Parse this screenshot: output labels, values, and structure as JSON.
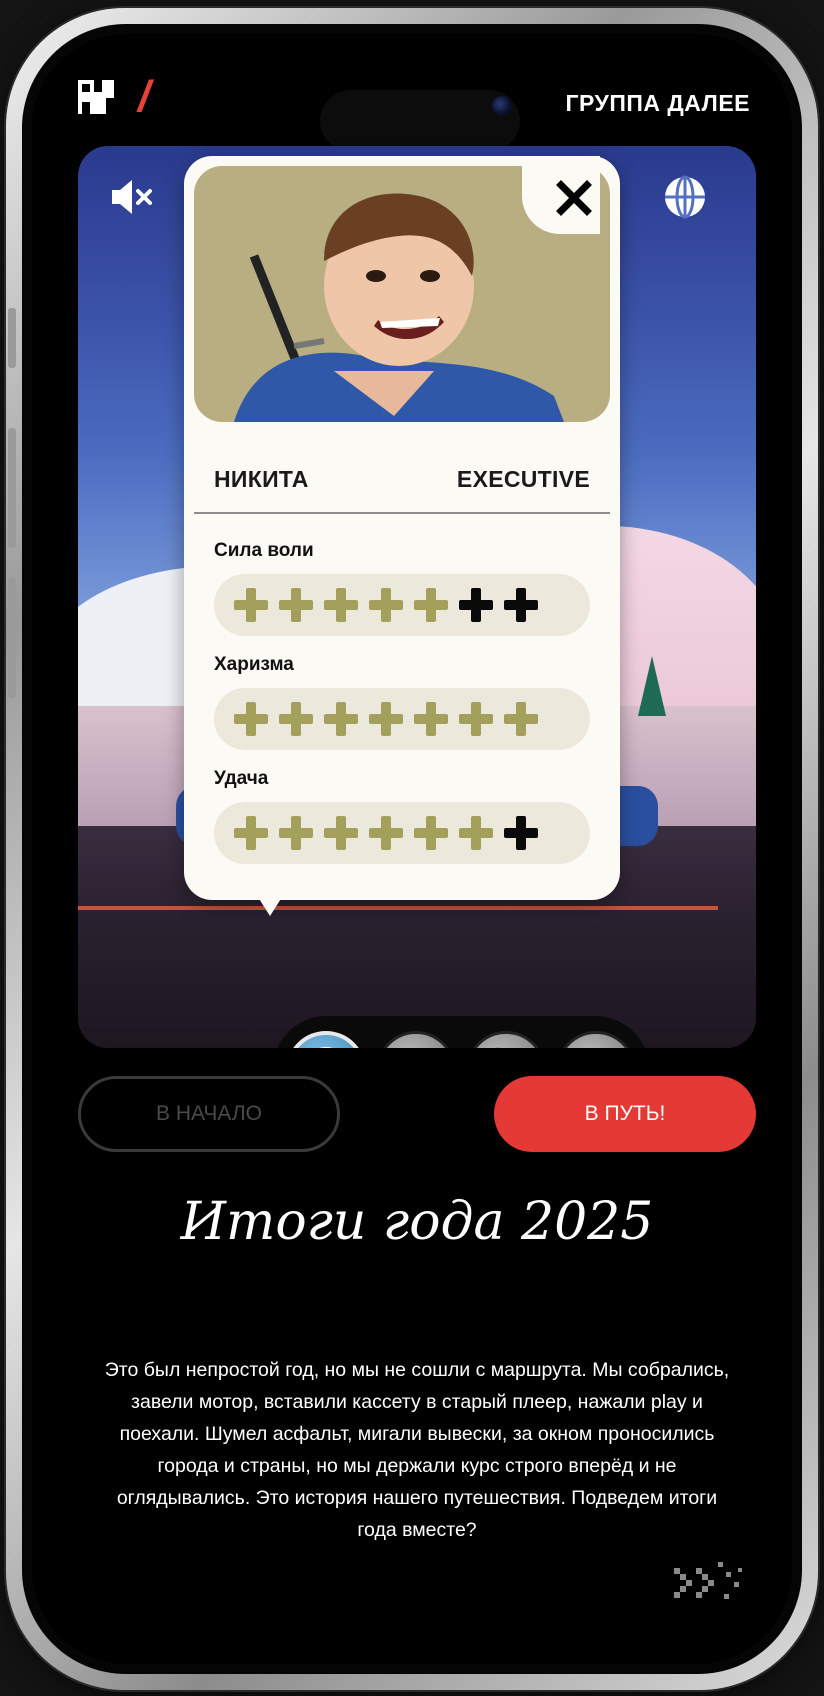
{
  "header": {
    "logo_mark": "N",
    "slash": "/",
    "nav_label": "ГРУППА ДАЛЕЕ"
  },
  "hero": {
    "icons": [
      "mute-icon",
      "globe-icon"
    ]
  },
  "card": {
    "name": "НИКИТА",
    "role": "EXECUTIVE",
    "stats": [
      {
        "label": "Сила воли",
        "value": 5,
        "max": 7
      },
      {
        "label": "Харизма",
        "value": 7,
        "max": 7
      },
      {
        "label": "Удача",
        "value": 6,
        "max": 7
      }
    ],
    "colors": {
      "filled": "#a3a05c",
      "empty": "#0a0a0a",
      "portrait_bg": "#b9ae82"
    }
  },
  "selector": {
    "items": [
      "target-icon",
      "rock-hand-icon",
      "wrench-icon",
      "brush-icon"
    ],
    "active_index": 0
  },
  "buttons": {
    "start": "В НАЧАЛО",
    "go": "В ПУТЬ!"
  },
  "content": {
    "title": "Итоги года 2025",
    "text": "Это был непростой год, но мы не сошли с маршрута. Мы собрались, завели мотор, вставили кассету в старый плеер, нажали play и поехали. Шумел асфальт, мигали вывески, за окном проносились города и страны, но мы держали курс строго вперёд и не оглядывались. Это история нашего путешествия. Подведем итоги года вместе?"
  },
  "colors": {
    "accent": "#e53935",
    "background": "#000000"
  }
}
